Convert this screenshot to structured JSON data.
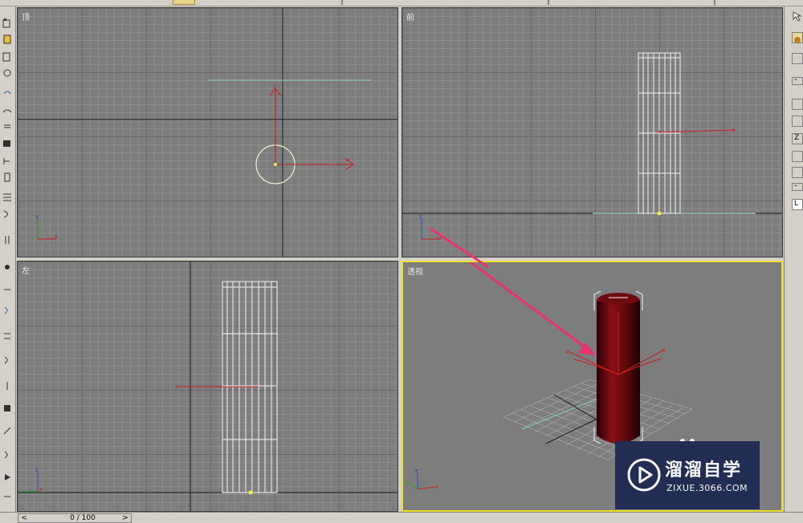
{
  "viewports": {
    "top": {
      "label": "顶"
    },
    "front": {
      "label": "前"
    },
    "left": {
      "label": "左"
    },
    "perspective": {
      "label": "透视"
    }
  },
  "axis_letters": {
    "x": "x",
    "y": "y",
    "z": "z"
  },
  "timeline": {
    "frame_text": "0 / 100",
    "prev_label": "<",
    "next_label": ">"
  },
  "right_panel": {
    "minus_label": "-",
    "letter_l": "L",
    "letter_z": "Z"
  },
  "watermark": {
    "title": "溜溜自学",
    "url": "ZIXUE.3066.COM"
  },
  "colors": {
    "active_border": "#f0e028",
    "cylinder": "#7a0d12",
    "arrow": "#e8336e",
    "axis_red": "#c82020",
    "grid_major": "#696969"
  },
  "icons": [
    "select-icon",
    "move-icon",
    "rotate-icon",
    "scale-icon",
    "link-icon",
    "play-icon"
  ]
}
